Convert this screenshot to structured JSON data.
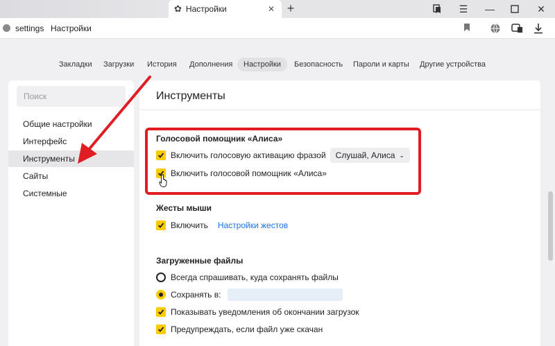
{
  "browser": {
    "tab_title": "Настройки",
    "tab_icon": "gear-icon",
    "address": {
      "url_text": "settings",
      "page_title": "Настройки"
    }
  },
  "nav": {
    "items": [
      "Закладки",
      "Загрузки",
      "История",
      "Дополнения",
      "Настройки",
      "Безопасность",
      "Пароли и карты",
      "Другие устройства"
    ],
    "active": "Настройки"
  },
  "sidebar": {
    "search_placeholder": "Поиск",
    "items": [
      "Общие настройки",
      "Интерфейс",
      "Инструменты",
      "Сайты",
      "Системные"
    ],
    "active": "Инструменты"
  },
  "content": {
    "title": "Инструменты",
    "voice": {
      "title": "Голосовой помощник «Алиса»",
      "activation_label": "Включить голосовую активацию фразой",
      "activation_checked": true,
      "phrase_select": "Слушай, Алиса",
      "assistant_label": "Включить голосовой помощник «Алиса»",
      "assistant_checked": true
    },
    "gestures": {
      "title": "Жесты мыши",
      "enable_label": "Включить",
      "enable_checked": true,
      "settings_link": "Настройки жестов"
    },
    "downloads": {
      "title": "Загруженные файлы",
      "ask_label": "Всегда спрашивать, куда сохранять файлы",
      "ask_selected": false,
      "save_to_label": "Сохранять в:",
      "save_to_selected": true,
      "notify_label": "Показывать уведомления об окончании загрузок",
      "notify_checked": true,
      "warn_label": "Предупреждать, если файл уже скачан",
      "warn_checked": true
    }
  },
  "colors": {
    "accent": "#ffcc00",
    "link": "#1b73e8",
    "highlight": "#e11d24"
  }
}
